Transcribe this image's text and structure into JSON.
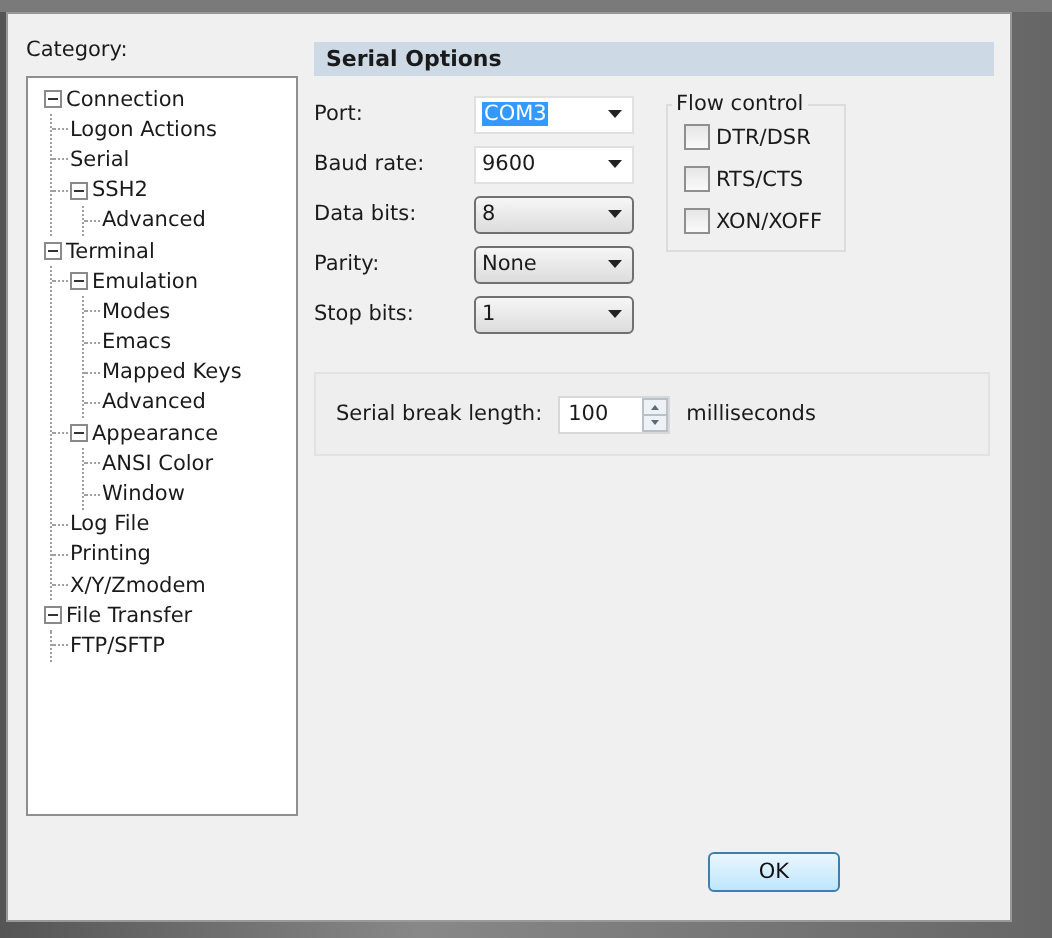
{
  "category_label": "Category:",
  "tree": [
    {
      "label": "Connection",
      "expanded": true,
      "children": [
        {
          "label": "Logon Actions"
        },
        {
          "label": "Serial"
        },
        {
          "label": "SSH2",
          "expanded": true,
          "children": [
            {
              "label": "Advanced"
            }
          ]
        }
      ]
    },
    {
      "label": "Terminal",
      "expanded": true,
      "children": [
        {
          "label": "Emulation",
          "expanded": true,
          "children": [
            {
              "label": "Modes"
            },
            {
              "label": "Emacs"
            },
            {
              "label": "Mapped Keys"
            },
            {
              "label": "Advanced"
            }
          ]
        },
        {
          "label": "Appearance",
          "expanded": true,
          "children": [
            {
              "label": "ANSI Color"
            },
            {
              "label": "Window"
            }
          ]
        },
        {
          "label": "Log File"
        },
        {
          "label": "Printing"
        },
        {
          "label": "X/Y/Zmodem"
        }
      ]
    },
    {
      "label": "File Transfer",
      "expanded": true,
      "children": [
        {
          "label": "FTP/SFTP"
        }
      ]
    }
  ],
  "section_title": "Serial Options",
  "fields": [
    {
      "label": "Port:",
      "value": "COM3",
      "kind": "combo",
      "highlighted": true
    },
    {
      "label": "Baud rate:",
      "value": "9600",
      "kind": "combo",
      "highlighted": false
    },
    {
      "label": "Data bits:",
      "value": "8",
      "kind": "dropdown",
      "highlighted": false
    },
    {
      "label": "Parity:",
      "value": "None",
      "kind": "dropdown",
      "highlighted": false
    },
    {
      "label": "Stop bits:",
      "value": "1",
      "kind": "dropdown",
      "highlighted": false
    }
  ],
  "flow_control": {
    "title": "Flow control",
    "options": [
      {
        "label": "DTR/DSR",
        "checked": false
      },
      {
        "label": "RTS/CTS",
        "checked": false
      },
      {
        "label": "XON/XOFF",
        "checked": false
      }
    ]
  },
  "break_length": {
    "label": "Serial break length:",
    "value": "100",
    "unit": "milliseconds"
  },
  "buttons": [
    "OK"
  ]
}
